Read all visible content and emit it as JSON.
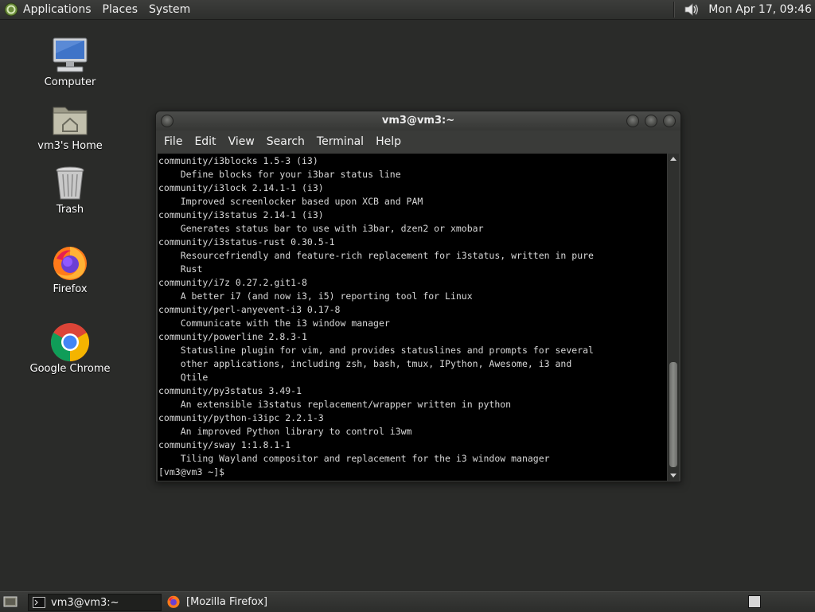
{
  "top_panel": {
    "menus": [
      "Applications",
      "Places",
      "System"
    ],
    "icons": {
      "distro": "distro-logo-icon",
      "volume": "volume-icon"
    },
    "clock": "Mon Apr 17, 09:46"
  },
  "desktop": {
    "icons": [
      {
        "label": "Computer",
        "icon": "computer-icon"
      },
      {
        "label": "vm3's Home",
        "icon": "home-folder-icon"
      },
      {
        "label": "Trash",
        "icon": "trash-icon"
      },
      {
        "label": "Firefox",
        "icon": "firefox-icon"
      },
      {
        "label": "Google Chrome",
        "icon": "chrome-icon"
      }
    ]
  },
  "terminal": {
    "title": "vm3@vm3:~",
    "menus": [
      "File",
      "Edit",
      "View",
      "Search",
      "Terminal",
      "Help"
    ],
    "lines": [
      "community/i3blocks 1.5-3 (i3)",
      "    Define blocks for your i3bar status line",
      "community/i3lock 2.14.1-1 (i3)",
      "    Improved screenlocker based upon XCB and PAM",
      "community/i3status 2.14-1 (i3)",
      "    Generates status bar to use with i3bar, dzen2 or xmobar",
      "community/i3status-rust 0.30.5-1",
      "    Resourcefriendly and feature-rich replacement for i3status, written in pure",
      "    Rust",
      "community/i7z 0.27.2.git1-8",
      "    A better i7 (and now i3, i5) reporting tool for Linux",
      "community/perl-anyevent-i3 0.17-8",
      "    Communicate with the i3 window manager",
      "community/powerline 2.8.3-1",
      "    Statusline plugin for vim, and provides statuslines and prompts for several",
      "    other applications, including zsh, bash, tmux, IPython, Awesome, i3 and",
      "    Qtile",
      "community/py3status 3.49-1",
      "    An extensible i3status replacement/wrapper written in python",
      "community/python-i3ipc 2.2.1-3",
      "    An improved Python library to control i3wm",
      "community/sway 1:1.8.1-1",
      "    Tiling Wayland compositor and replacement for the i3 window manager",
      "[vm3@vm3 ~]$ "
    ]
  },
  "taskbar": {
    "items": [
      {
        "label": "vm3@vm3:~",
        "icon": "terminal-icon",
        "active": true
      },
      {
        "label": "[Mozilla Firefox]",
        "icon": "firefox-icon",
        "active": false
      }
    ],
    "icons": {
      "show_desktop": "show-desktop-icon",
      "workspace": "workspace-switcher-icon"
    }
  }
}
